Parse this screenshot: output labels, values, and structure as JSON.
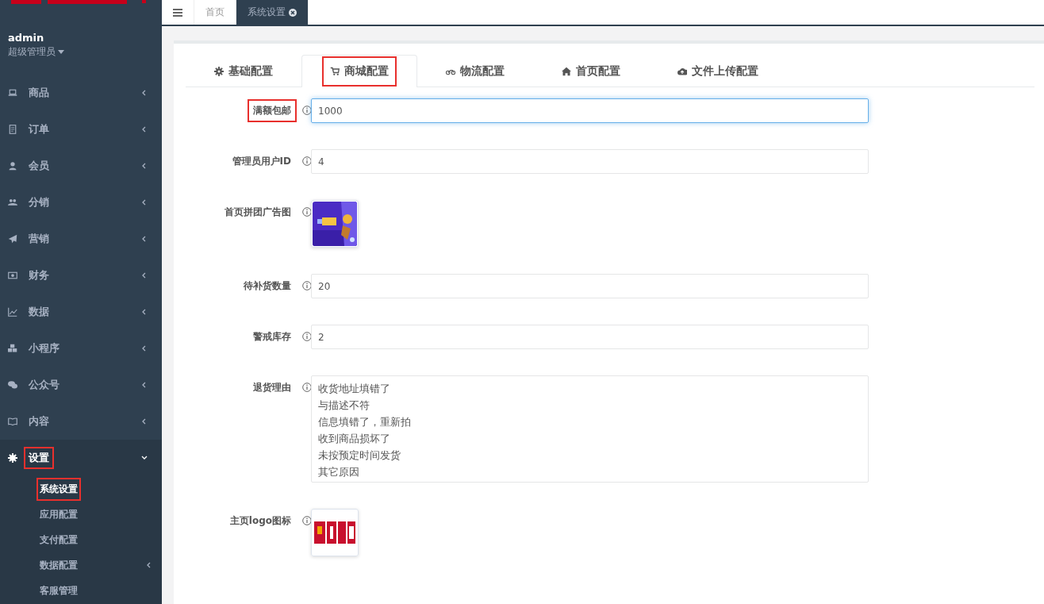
{
  "sidebar": {
    "user": {
      "name": "admin",
      "role": "超级管理员"
    },
    "items": [
      {
        "label": "商品",
        "expanded": false,
        "highlighted": false
      },
      {
        "label": "订单",
        "expanded": false,
        "highlighted": false
      },
      {
        "label": "会员",
        "expanded": false,
        "highlighted": false
      },
      {
        "label": "分销",
        "expanded": false,
        "highlighted": false
      },
      {
        "label": "营销",
        "expanded": false,
        "highlighted": false
      },
      {
        "label": "财务",
        "expanded": false,
        "highlighted": false
      },
      {
        "label": "数据",
        "expanded": false,
        "highlighted": false
      },
      {
        "label": "小程序",
        "expanded": false,
        "highlighted": false
      },
      {
        "label": "公众号",
        "expanded": false,
        "highlighted": false
      },
      {
        "label": "内容",
        "expanded": false,
        "highlighted": false
      },
      {
        "label": "设置",
        "expanded": true,
        "highlighted": true,
        "children": [
          {
            "label": "系统设置",
            "selected": true,
            "highlighted": true,
            "has_submenu": false
          },
          {
            "label": "应用配置",
            "selected": false,
            "highlighted": false,
            "has_submenu": false
          },
          {
            "label": "支付配置",
            "selected": false,
            "highlighted": false,
            "has_submenu": false
          },
          {
            "label": "数据配置",
            "selected": false,
            "highlighted": false,
            "has_submenu": true
          },
          {
            "label": "客服管理",
            "selected": false,
            "highlighted": false,
            "has_submenu": false
          }
        ]
      }
    ]
  },
  "topbar": {
    "tabs": [
      {
        "label": "首页",
        "selected": false,
        "closable": false
      },
      {
        "label": "系统设置",
        "selected": true,
        "closable": true
      }
    ]
  },
  "config_tabs": [
    {
      "label": "基础配置",
      "selected": false,
      "highlighted": false
    },
    {
      "label": "商城配置",
      "selected": true,
      "highlighted": true
    },
    {
      "label": "物流配置",
      "selected": false,
      "highlighted": false
    },
    {
      "label": "首页配置",
      "selected": false,
      "highlighted": false
    },
    {
      "label": "文件上传配置",
      "selected": false,
      "highlighted": false
    }
  ],
  "form": [
    {
      "kind": "input",
      "label": "满额包邮",
      "value": "1000",
      "focused": true,
      "highlighted": true
    },
    {
      "kind": "input",
      "label": "管理员用户ID",
      "value": "4",
      "focused": false,
      "highlighted": false
    },
    {
      "label": "首页拼团广告图",
      "highlighted": false
    },
    {
      "kind": "input",
      "label": "待补货数量",
      "value": "20",
      "focused": false,
      "highlighted": false
    },
    {
      "kind": "input",
      "label": "警戒库存",
      "value": "2",
      "focused": false,
      "highlighted": false
    },
    {
      "kind": "textarea",
      "label": "退货理由",
      "lines": [
        "收货地址填错了",
        "与描述不符",
        "信息填错了，重新拍",
        "收到商品损坏了",
        "未按预定时间发货",
        "其它原因"
      ],
      "highlighted": false
    },
    {
      "label": "主页logo图标",
      "highlighted": false
    }
  ]
}
